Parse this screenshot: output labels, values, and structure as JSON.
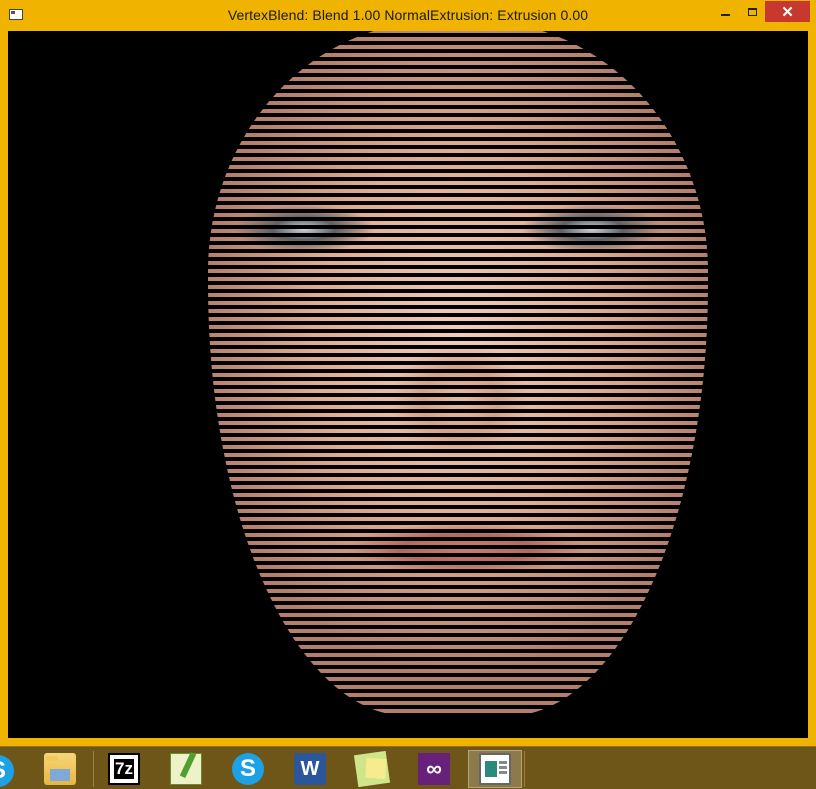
{
  "window": {
    "title": "VertexBlend: Blend 1.00 NormalExtrusion: Extrusion 0.00",
    "controls": {
      "minimize_icon": "minimize-icon",
      "maximize_icon": "maximize-icon",
      "close_glyph": "✕"
    }
  },
  "viewport": {
    "scene": "render-viewport",
    "background": "#000000",
    "skin_color": "#e2ab93"
  },
  "taskbar": {
    "items": [
      {
        "icon": "skype-icon",
        "glyph": "S"
      },
      {
        "icon": "file-explorer-icon"
      },
      {
        "icon": "7zip-icon",
        "glyph": "7z"
      },
      {
        "icon": "notepad-plus-plus-icon"
      },
      {
        "icon": "skype-icon",
        "glyph": "S"
      },
      {
        "icon": "word-icon",
        "glyph": "W"
      },
      {
        "icon": "sticky-notes-icon"
      },
      {
        "icon": "visual-studio-icon",
        "glyph": "∞"
      },
      {
        "icon": "vertexblend-app-icon",
        "active": true
      }
    ],
    "colors": {
      "taskbar_bg": "#6e5518",
      "window_frame": "#f0b400",
      "close_button": "#c7392f"
    }
  }
}
